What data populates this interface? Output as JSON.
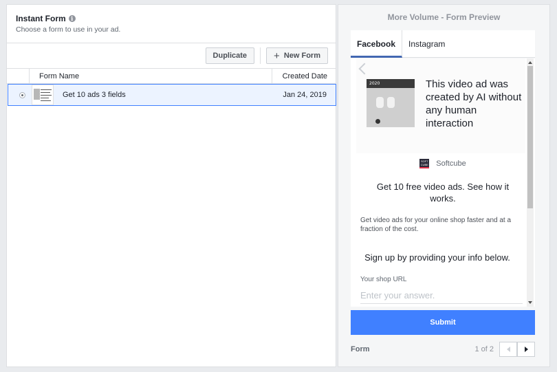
{
  "left_panel": {
    "title": "Instant Form",
    "subtitle": "Choose a form to use in your ad.",
    "info_icon": "i",
    "toolbar": {
      "duplicate_label": "Duplicate",
      "new_form_label": "New Form",
      "new_form_icon": "+"
    },
    "table": {
      "columns": [
        "Form Name",
        "Created Date"
      ],
      "rows": [
        {
          "name": "Get 10 ads 3 fields",
          "created": "Jan 24, 2019",
          "selected": true
        }
      ]
    }
  },
  "preview": {
    "title": "More Volume - Form Preview",
    "tabs": [
      {
        "label": "Facebook",
        "active": true
      },
      {
        "label": "Instagram",
        "active": false
      }
    ],
    "hero_text": "This video ad was created by AI without any human interaction",
    "hero_image_band": "2020",
    "brand_name": "Softcube",
    "brand_logo_text": "SOFT CUBE",
    "headline": "Get 10 free video ads. See how it works.",
    "description": "Get video ads for your online shop faster and at a fraction of the cost.",
    "signup_text": "Sign up by providing your info below.",
    "field_label": "Your shop URL",
    "field_placeholder": "Enter your answer.",
    "submit_label": "Submit",
    "footer": {
      "label": "Form",
      "page": "1 of 2"
    }
  },
  "colors": {
    "accent": "#4080ff",
    "tab_underline": "#4267b2",
    "selected_row_bg": "#ecf3ff"
  }
}
